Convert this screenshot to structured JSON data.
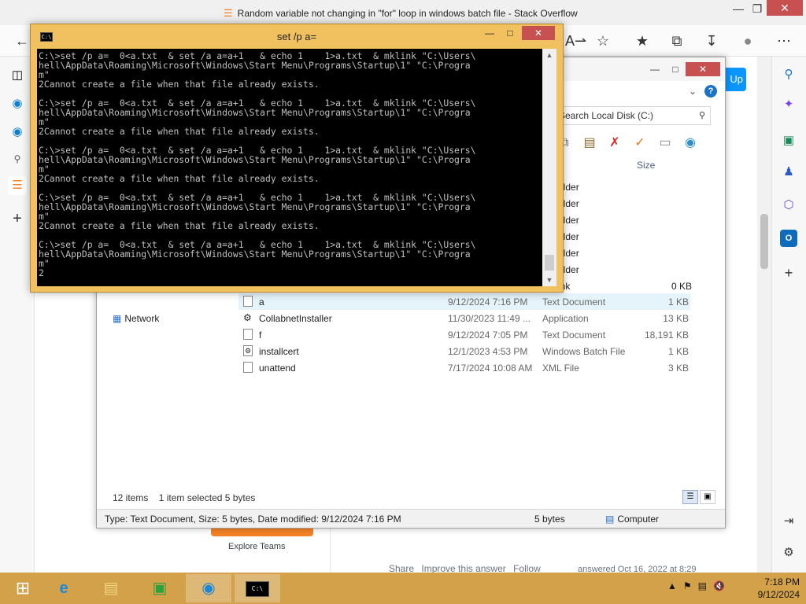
{
  "browser": {
    "window_title": "Random variable not changing in \"for\" loop in windows batch file - Stack Overflow",
    "sign_up": "Up"
  },
  "page": {
    "explore_teams": "Explore Teams",
    "answer_actions": [
      "Share",
      "Improve this answer",
      "Follow"
    ],
    "answered": "answered Oct 16, 2022 at 8:29"
  },
  "explorer": {
    "search_placeholder": "Search Local Disk (C:)",
    "column_size": "Size",
    "partial_rows": [
      {
        "type": "older",
        "size": ""
      },
      {
        "type": "older",
        "size": ""
      },
      {
        "type": "older",
        "size": ""
      },
      {
        "type": "older",
        "size": ""
      },
      {
        "type": "older",
        "size": ""
      },
      {
        "type": "older",
        "size": ""
      },
      {
        "type": "ink",
        "size": "0 KB"
      }
    ],
    "nav_network": "Network",
    "files": [
      {
        "name": "a",
        "date": "9/12/2024 7:16 PM",
        "type": "Text Document",
        "size": "1 KB",
        "selected": true
      },
      {
        "name": "CollabnetInstaller",
        "date": "11/30/2023 11:49 ...",
        "type": "Application",
        "size": "13 KB",
        "selected": false
      },
      {
        "name": "f",
        "date": "9/12/2024 7:05 PM",
        "type": "Text Document",
        "size": "18,191 KB",
        "selected": false
      },
      {
        "name": "installcert",
        "date": "12/1/2023 4:53 PM",
        "type": "Windows Batch File",
        "size": "1 KB",
        "selected": false
      },
      {
        "name": "unattend",
        "date": "7/17/2024 10:08 AM",
        "type": "XML File",
        "size": "3 KB",
        "selected": false
      }
    ],
    "status_items": "12 items",
    "status_selected": "1 item selected  5 bytes",
    "detail_type": "Type: Text Document, Size: 5 bytes, Date modified: 9/12/2024 7:16 PM",
    "detail_size": "5 bytes",
    "detail_location": "Computer"
  },
  "cmd": {
    "title": "set  /p a=",
    "output": "C:\\>set /p a=  0<a.txt  & set /a a=a+1   & echo 1    1>a.txt  & mklink \"C:\\Users\\\nhell\\AppData\\Roaming\\Microsoft\\Windows\\Start Menu\\Programs\\Startup\\1\" \"C:\\Progra\nm\"\n2Cannot create a file when that file already exists.\n\nC:\\>set /p a=  0<a.txt  & set /a a=a+1   & echo 1    1>a.txt  & mklink \"C:\\Users\\\nhell\\AppData\\Roaming\\Microsoft\\Windows\\Start Menu\\Programs\\Startup\\1\" \"C:\\Progra\nm\"\n2Cannot create a file when that file already exists.\n\nC:\\>set /p a=  0<a.txt  & set /a a=a+1   & echo 1    1>a.txt  & mklink \"C:\\Users\\\nhell\\AppData\\Roaming\\Microsoft\\Windows\\Start Menu\\Programs\\Startup\\1\" \"C:\\Progra\nm\"\n2Cannot create a file when that file already exists.\n\nC:\\>set /p a=  0<a.txt  & set /a a=a+1   & echo 1    1>a.txt  & mklink \"C:\\Users\\\nhell\\AppData\\Roaming\\Microsoft\\Windows\\Start Menu\\Programs\\Startup\\1\" \"C:\\Progra\nm\"\n2Cannot create a file when that file already exists.\n\nC:\\>set /p a=  0<a.txt  & set /a a=a+1   & echo 1    1>a.txt  & mklink \"C:\\Users\\\nhell\\AppData\\Roaming\\Microsoft\\Windows\\Start Menu\\Programs\\Startup\\1\" \"C:\\Progra\nm\"\n2"
  },
  "taskbar": {
    "time": "7:18 PM",
    "date": "9/12/2024"
  },
  "colors": {
    "taskbar": "#d2a14a",
    "cmd_frame": "#f0c15e",
    "selection": "#e5f3fb",
    "so_orange": "#f48225"
  }
}
